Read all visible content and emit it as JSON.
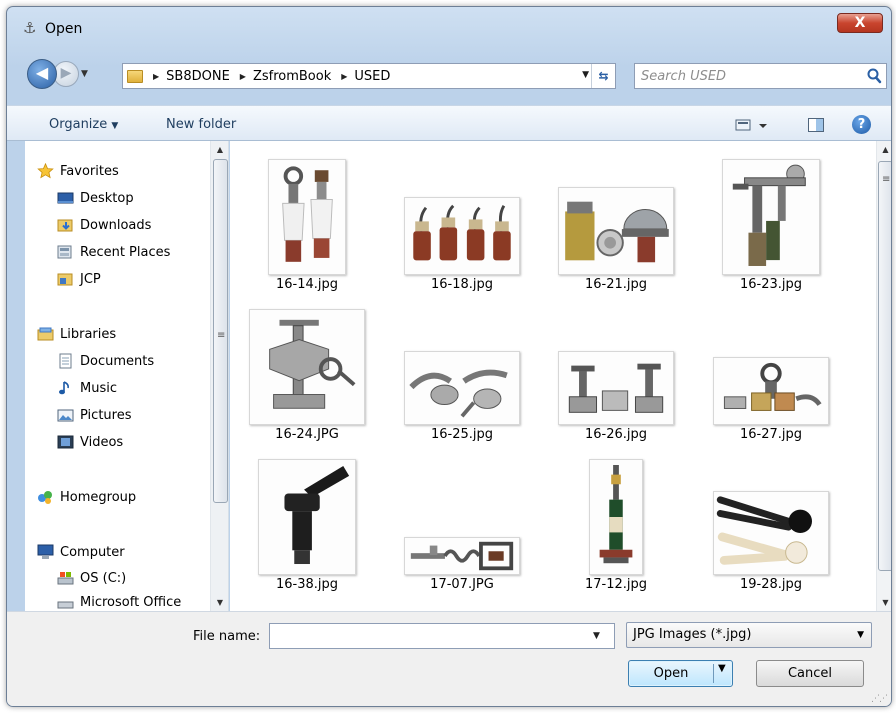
{
  "window": {
    "title": "Open",
    "close_label": "X"
  },
  "address": {
    "breadcrumbs": [
      "SB8DONE",
      "ZsfromBook",
      "USED"
    ]
  },
  "search": {
    "placeholder": "Search USED"
  },
  "toolbar": {
    "organize_label": "Organize",
    "new_folder_label": "New folder"
  },
  "nav": {
    "groups": [
      {
        "label": "Favorites",
        "icon": "star-icon",
        "children": [
          {
            "label": "Desktop",
            "icon": "desktop-icon"
          },
          {
            "label": "Downloads",
            "icon": "downloads-icon"
          },
          {
            "label": "Recent Places",
            "icon": "recent-places-icon"
          },
          {
            "label": "JCP",
            "icon": "folder-icon"
          }
        ]
      },
      {
        "label": "Libraries",
        "icon": "libraries-icon",
        "children": [
          {
            "label": "Documents",
            "icon": "documents-icon"
          },
          {
            "label": "Music",
            "icon": "music-icon"
          },
          {
            "label": "Pictures",
            "icon": "pictures-icon"
          },
          {
            "label": "Videos",
            "icon": "videos-icon"
          }
        ]
      },
      {
        "label": "Homegroup",
        "icon": "homegroup-icon",
        "children": []
      },
      {
        "label": "Computer",
        "icon": "computer-icon",
        "children": [
          {
            "label": "OS (C:)",
            "icon": "drive-icon"
          },
          {
            "label": "Microsoft Office",
            "icon": "drive-icon"
          }
        ]
      }
    ]
  },
  "files": [
    {
      "name": "16-14.jpg",
      "subject": "two ring-top stoppers"
    },
    {
      "name": "16-18.jpg",
      "subject": "four cork stoppers"
    },
    {
      "name": "16-21.jpg",
      "subject": "cap and corks"
    },
    {
      "name": "16-23.jpg",
      "subject": "bench corker"
    },
    {
      "name": "16-24.JPG",
      "subject": "mechanical corkscrew"
    },
    {
      "name": "16-25.jpg",
      "subject": "lever openers"
    },
    {
      "name": "16-26.jpg",
      "subject": "clamp tools"
    },
    {
      "name": "16-27.jpg",
      "subject": "capping tools"
    },
    {
      "name": "16-38.jpg",
      "subject": "black lever pump"
    },
    {
      "name": "17-07.JPG",
      "subject": "spiral tool"
    },
    {
      "name": "17-12.jpg",
      "subject": "champagne bottle stand"
    },
    {
      "name": "19-28.jpg",
      "subject": "pliers pair"
    }
  ],
  "bottom": {
    "filename_label": "File name:",
    "filename_value": "",
    "filetype_selected": "JPG Images (*.jpg)",
    "open_label": "Open",
    "cancel_label": "Cancel"
  }
}
